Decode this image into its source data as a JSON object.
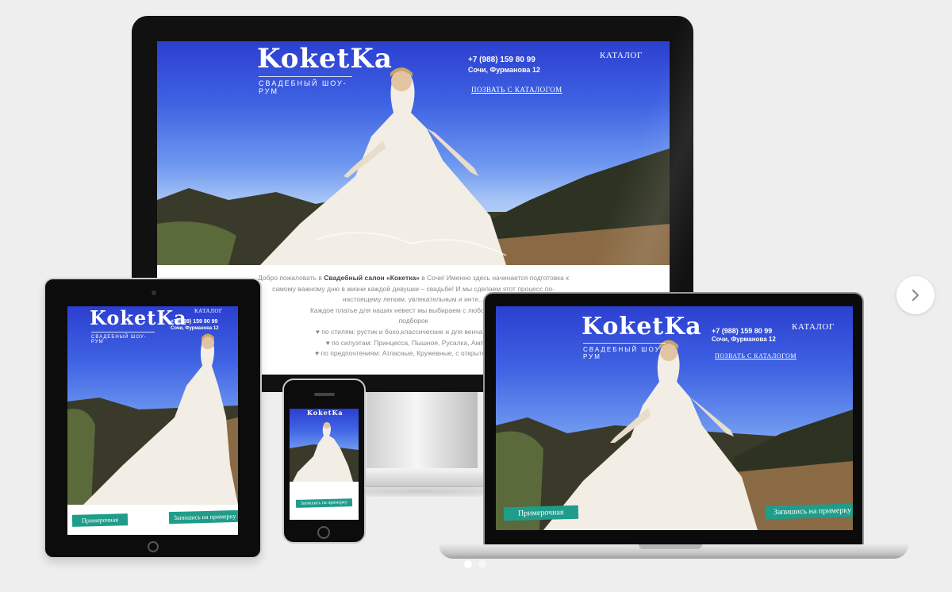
{
  "site": {
    "logo": "KoketKa",
    "tagline": "СВАДЕБНЫЙ ШОУ-РУМ",
    "phone": "+7 (988) 159 80 99",
    "address": "Сочи, Фурманова 12",
    "call_link": "ПОЗВАТЬ С КАТАЛОГОМ",
    "catalog_link": "КАТАЛОГ",
    "cta_fitting": "Примерочная",
    "cta_signup": "Запишись на примерку"
  },
  "body_text": {
    "line1_prefix": "Добро пожаловать в",
    "line1_bold": "Свадебный салон «Кокетка»",
    "line1_suffix": "в Сочи! Именно здесь начинается подготовка к",
    "line2": "самому важному дню в жизни каждой девушки – свадьбе! И мы сделаем этот процесс по-",
    "line3": "настоящему легким, увлекательным и инте...",
    "line4": "Каждое платье для наших невест мы выбираем с любовью. Мы...",
    "line5": "подборок",
    "line6": "♥ по стилям: рустик и бохо,классические и для венчания, дл...",
    "line7": "♥ по силуэтам: Принцесса, Пышное, Русалка, Ампир, ...",
    "line8": "♥ по предпочтениям: Атласные, Кружевные, с открытой спин..."
  },
  "carousel": {
    "next_icon": "chevron-right-icon",
    "active_dot": 0,
    "dot_count": 2
  },
  "colors": {
    "background": "#eeeeee",
    "accent": "#1f9c8a",
    "device": "#0c0c0c"
  }
}
